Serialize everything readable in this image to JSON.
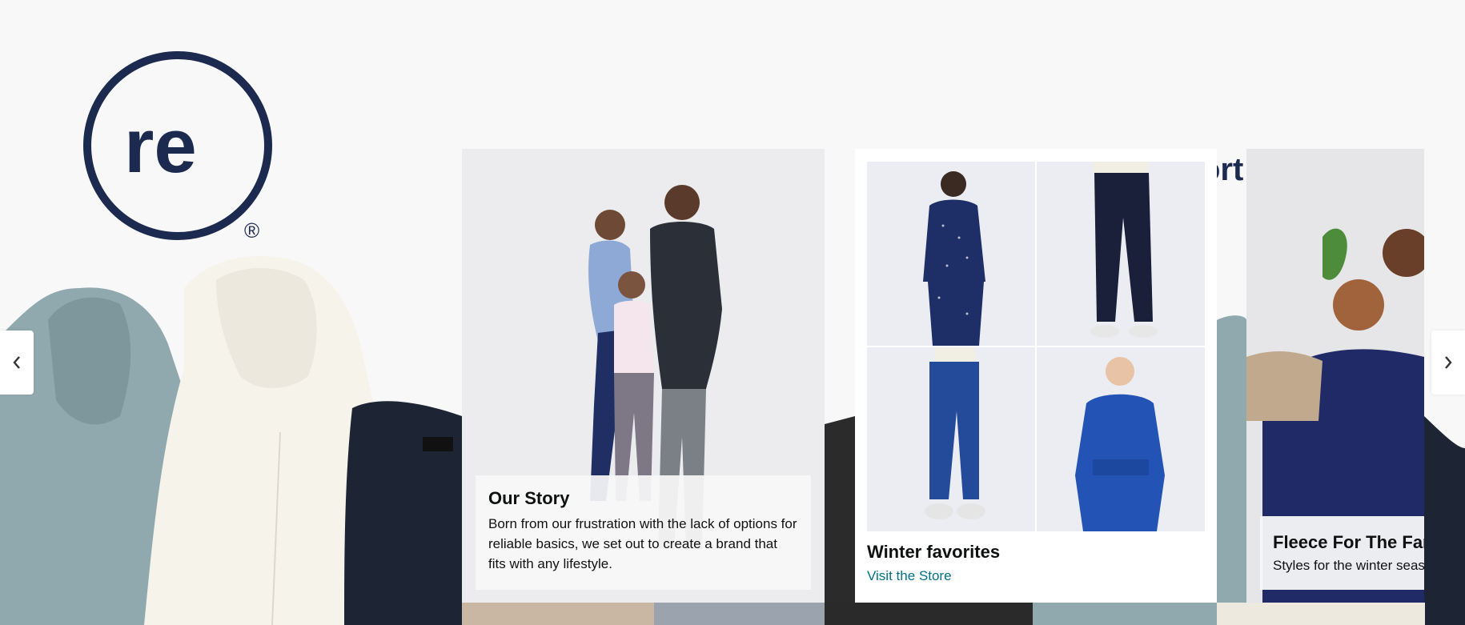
{
  "brand": {
    "logo_text": "re",
    "registered_mark": "®",
    "color": "#1b2a4e"
  },
  "partial_heading": "ort",
  "carousel": {
    "prev_icon": "chevron-left-icon",
    "next_icon": "chevron-right-icon",
    "cards": {
      "story": {
        "title": "Our Story",
        "text": "Born from our frustration with the lack of options for reliable basics, we set out to create a brand that fits with any lifestyle."
      },
      "winter": {
        "title": "Winter favorites",
        "link": "Visit the Store",
        "tiles": [
          "women-pajama-set",
          "navy-joggers",
          "blue-joggers",
          "blue-long-sleeve-tee"
        ]
      },
      "fleece": {
        "title": "Fleece For The Family",
        "text": "Styles for the winter season"
      }
    }
  },
  "colors": {
    "link": "#007185",
    "navy": "#1b2a4e",
    "background": "#f8f8f9"
  }
}
